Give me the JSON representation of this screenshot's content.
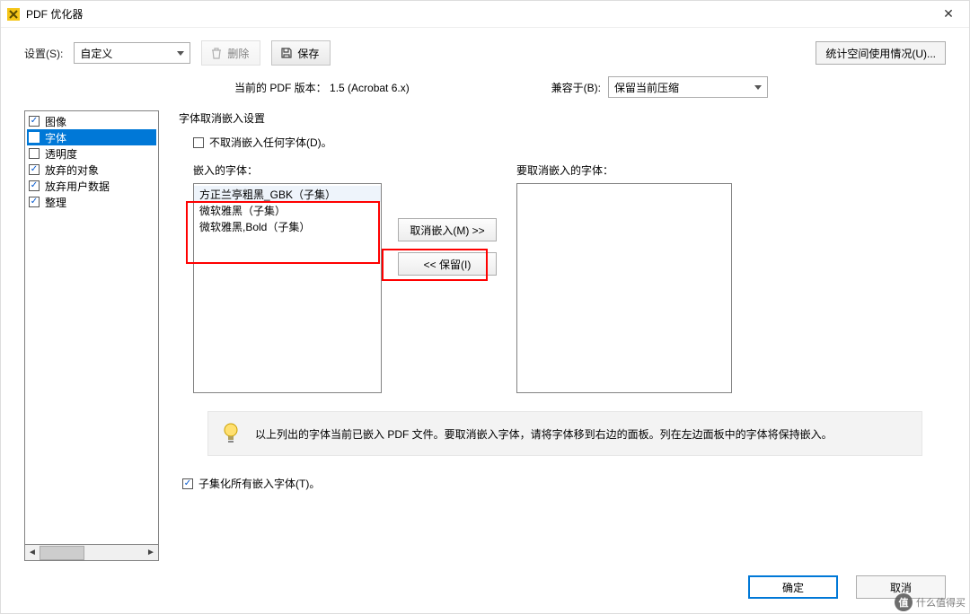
{
  "window": {
    "title": "PDF 优化器"
  },
  "toolbar": {
    "settings_label": "设置(S):",
    "settings_value": "自定义",
    "delete_label": "删除",
    "save_label": "保存",
    "stats_label": "统计空间使用情况(U)..."
  },
  "meta": {
    "current_version_label": "当前的 PDF 版本：",
    "current_version_value": "1.5 (Acrobat 6.x)",
    "compat_label": "兼容于(B):",
    "compat_value": "保留当前压缩"
  },
  "sidebar": {
    "items": [
      {
        "label": "图像",
        "checked": true,
        "selected": false
      },
      {
        "label": "字体",
        "checked": true,
        "selected": true
      },
      {
        "label": "透明度",
        "checked": false,
        "selected": false
      },
      {
        "label": "放弃的对象",
        "checked": true,
        "selected": false
      },
      {
        "label": "放弃用户数据",
        "checked": true,
        "selected": false
      },
      {
        "label": "整理",
        "checked": true,
        "selected": false
      }
    ]
  },
  "fonts_panel": {
    "section_title": "字体取消嵌入设置",
    "no_unembed_label": "不取消嵌入任何字体(D)。",
    "no_unembed_checked": false,
    "embedded_label": "嵌入的字体：",
    "embedded_list": [
      "方正兰亭粗黑_GBK（子集）",
      "微软雅黑（子集）",
      "微软雅黑,Bold（子集）"
    ],
    "unembed_label": "要取消嵌入的字体：",
    "btn_unembed": "取消嵌入(M) >>",
    "btn_keep": "<< 保留(I)",
    "info_text": "以上列出的字体当前已嵌入 PDF 文件。要取消嵌入字体，请将字体移到右边的面板。列在左边面板中的字体将保持嵌入。",
    "subset_label": "子集化所有嵌入字体(T)。",
    "subset_checked": true
  },
  "footer": {
    "ok": "确定",
    "cancel": "取消"
  },
  "watermark": {
    "badge": "值",
    "text": "什么值得买"
  }
}
